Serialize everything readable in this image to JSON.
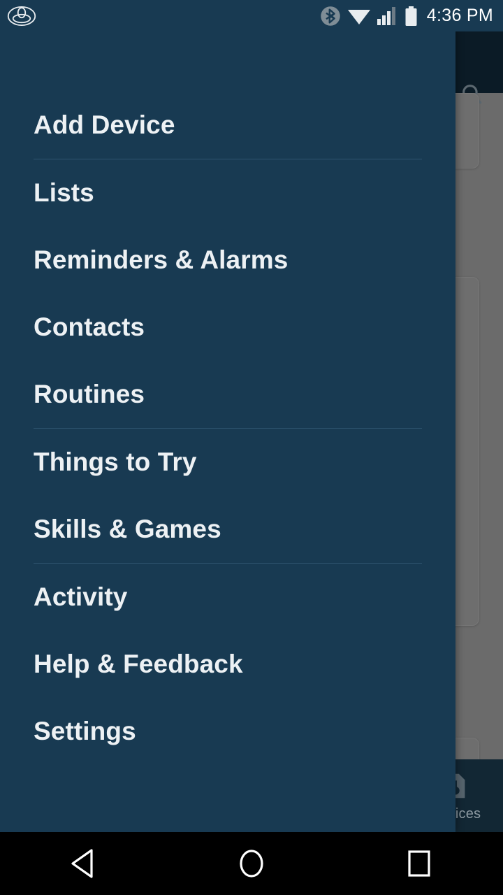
{
  "status_bar": {
    "app_logo_icon": "toyota-logo-icon",
    "icons": [
      "bluetooth-icon",
      "wifi-icon",
      "cellular-signal-icon",
      "battery-icon"
    ],
    "clock": "4:36 PM",
    "background_color": "#183a52"
  },
  "drawer": {
    "background_color": "#183a52",
    "text_color": "#edf1f4",
    "divider_color": "#2f5570",
    "items": [
      {
        "label": "Add Device",
        "divider_after": true
      },
      {
        "label": "Lists",
        "divider_after": false
      },
      {
        "label": "Reminders & Alarms",
        "divider_after": false
      },
      {
        "label": "Contacts",
        "divider_after": false
      },
      {
        "label": "Routines",
        "divider_after": true
      },
      {
        "label": "Things to Try",
        "divider_after": false
      },
      {
        "label": "Skills & Games",
        "divider_after": true
      },
      {
        "label": "Activity",
        "divider_after": false
      },
      {
        "label": "Help & Feedback",
        "divider_after": false
      },
      {
        "label": "Settings",
        "divider_after": false
      }
    ]
  },
  "background_app": {
    "header": {
      "background_color": "#0b1b26",
      "search_icon": "search-icon"
    },
    "scrim_color": "#6b6b6b",
    "cards": [
      {
        "id": "card-1"
      },
      {
        "id": "card-2"
      },
      {
        "id": "card-3"
      }
    ],
    "bottom_tabs": [
      {
        "label": "Devices",
        "icon": "devices-icon"
      }
    ]
  },
  "android_navbar": {
    "background_color": "#000000",
    "buttons": [
      {
        "name": "back-button",
        "icon": "triangle-back-icon"
      },
      {
        "name": "home-button",
        "icon": "circle-home-icon"
      },
      {
        "name": "recents-button",
        "icon": "square-recents-icon"
      }
    ]
  }
}
